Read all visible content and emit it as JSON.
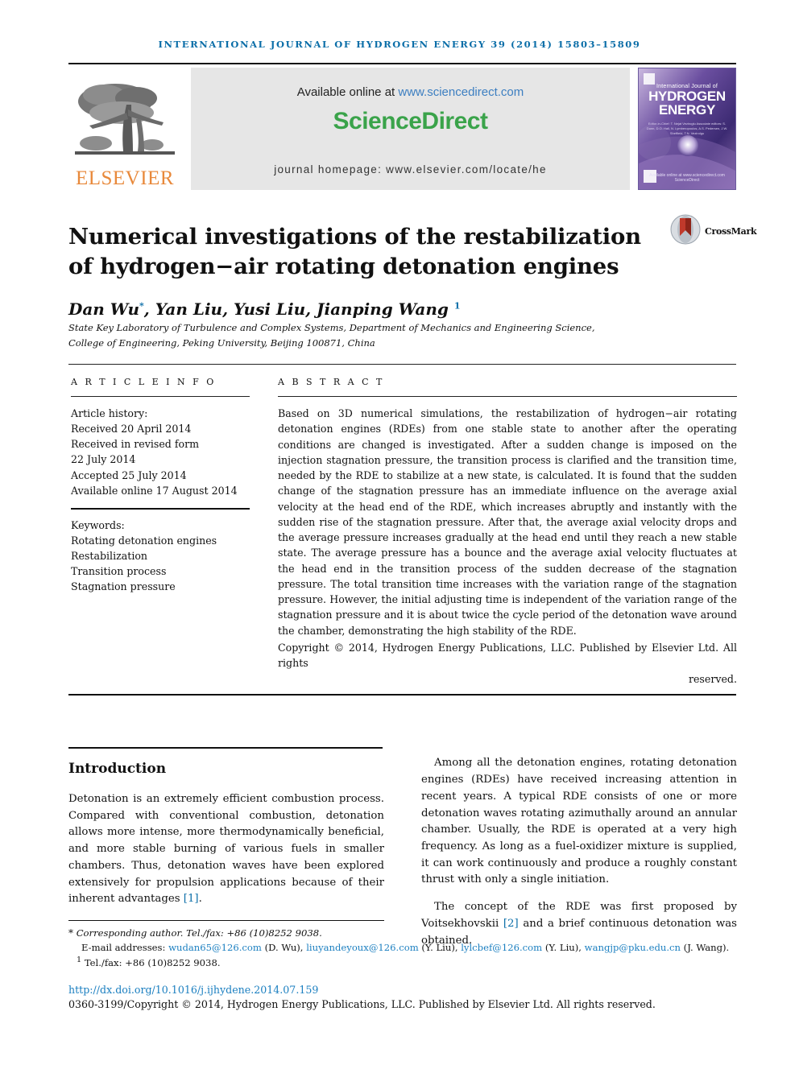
{
  "running_head": "International Journal of Hydrogen Energy 39 (2014) 15803–15809",
  "masthead": {
    "publisher": "ELSEVIER",
    "publisher_logo_icon": "elsevier-tree-icon",
    "available_prefix": "Available online at ",
    "available_url": "www.sciencedirect.com",
    "sciencedirect_logo": "ScienceDirect",
    "journal_homepage": "journal homepage: www.elsevier.com/locate/he",
    "cover": {
      "line1": "International Journal of",
      "line2": "HYDROGEN",
      "line3": "ENERGY",
      "editors": "Editor-in-Chief: T. Nejat Veziroglu   Associate editors: S. Dunn, D.O. Hall, N. Lymberopoulos, A.S. Pedersen, J.W. Sheffield, T.N. Vezirolgu",
      "footer": "Available online at www.sciencedirect.com   ScienceDirect"
    }
  },
  "title": "Numerical investigations of the restabilization of hydrogen−air rotating detonation engines",
  "crossmark": {
    "label": "CrossMark",
    "icon": "crossmark-icon"
  },
  "authors": {
    "names_1": "Dan Wu",
    "star": "*",
    "names_2": ", Yan Liu, Yusi Liu, Jianping Wang ",
    "footnote_mark": "1"
  },
  "affiliation_line1": "State Key Laboratory of Turbulence and Complex Systems, Department of Mechanics and Engineering Science,",
  "affiliation_line2": "College of Engineering, Peking University, Beijing 100871, China",
  "article_info": {
    "heading": "A R T I C L E   I N F O",
    "history_heading": "Article history:",
    "history": [
      "Received 20 April 2014",
      "Received in revised form",
      "22 July 2014",
      "Accepted 25 July 2014",
      "Available online 17 August 2014"
    ],
    "keywords_heading": "Keywords:",
    "keywords": [
      "Rotating detonation engines",
      "Restabilization",
      "Transition process",
      "Stagnation pressure"
    ]
  },
  "abstract": {
    "heading": "A B S T R A C T",
    "text": "Based on 3D numerical simulations, the restabilization of hydrogen−air rotating detonation engines (RDEs) from one stable state to another after the operating conditions are changed is investigated. After a sudden change is imposed on the injection stagnation pressure, the transition process is clarified and the transition time, needed by the RDE to stabilize at a new state, is calculated. It is found that the sudden change of the stagnation pressure has an immediate influence on the average axial velocity at the head end of the RDE, which increases abruptly and instantly with the sudden rise of the stagnation pressure. After that, the average axial velocity drops and the average pressure increases gradually at the head end until they reach a new stable state. The average pressure has a bounce and the average axial velocity fluctuates at the head end in the transition process of the sudden decrease of the stagnation pressure. The total transition time increases with the variation range of the stagnation pressure. However, the initial adjusting time is independent of the variation range of the stagnation pressure and it is about twice the cycle period of the detonation wave around the chamber, demonstrating the high stability of the RDE.",
    "copyright": "Copyright © 2014, Hydrogen Energy Publications, LLC. Published by Elsevier Ltd. All rights",
    "copyright_tail": "reserved."
  },
  "body": {
    "intro_heading": "Introduction",
    "left_p1_a": "Detonation is an extremely efficient combustion process. Compared with conventional combustion, detonation allows more intense, more thermodynamically beneficial, and more stable burning of various fuels in smaller chambers. Thus, detonation waves have been explored extensively for propulsion applications because of their inherent advantages ",
    "left_p1_ref": "[1]",
    "left_p1_b": ".",
    "right_p1": "Among all the detonation engines, rotating detonation engines (RDEs) have received increasing attention in recent years. A typical RDE consists of one or more detonation waves rotating azimuthally around an annular chamber. Usually, the RDE is operated at a very high frequency. As long as a fuel-oxidizer mixture is supplied, it can work continuously and produce a roughly constant thrust with only a single initiation.",
    "right_p2_a": "The concept of the RDE was first proposed by Voitsekhovskii ",
    "right_p2_ref": "[2]",
    "right_p2_b": " and a brief continuous detonation was obtained."
  },
  "footnotes": {
    "corresponding": "Corresponding author. Tel./fax: +86 (10)8252 9038.",
    "email_label": "E-mail addresses: ",
    "emails": [
      {
        "address": "wudan65@126.com",
        "person": " (D. Wu), "
      },
      {
        "address": "liuyandeyoux@126.com",
        "person": " (Y. Liu), "
      },
      {
        "address": "lylcbef@126.com",
        "person": " (Y. Liu), "
      },
      {
        "address": "wangjp@pku.edu.cn",
        "person": " (J. Wang)."
      }
    ],
    "telfax_mark": "1",
    "telfax": " Tel./fax: +86 (10)8252 9038.",
    "doi": "http://dx.doi.org/10.1016/j.ijhydene.2014.07.159",
    "issn_line": "0360-3199/Copyright © 2014, Hydrogen Energy Publications, LLC. Published by Elsevier Ltd. All rights reserved."
  },
  "colors": {
    "link": "#1b7fc0",
    "running_head": "#0b6ea8",
    "elsevier_orange": "#e8893b",
    "sciencedirect_green": "#3aa34a"
  }
}
